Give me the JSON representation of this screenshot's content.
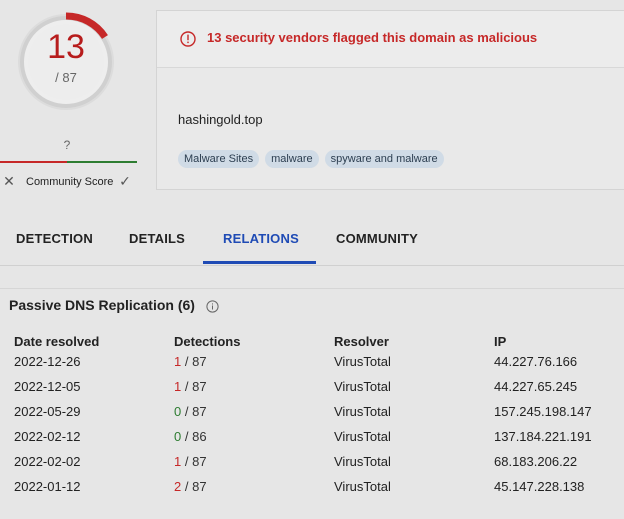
{
  "score": {
    "detected": "13",
    "total": "/ 87"
  },
  "community": {
    "question": "?",
    "label": "Community Score",
    "dislike_icon": "x-icon",
    "like_icon": "check-icon"
  },
  "alert": {
    "text": "13 security vendors flagged this domain as malicious",
    "icon": "alert-circle-icon",
    "color": "#c62828"
  },
  "domain": "hashingold.top",
  "tags": [
    "Malware Sites",
    "malware",
    "spyware and malware"
  ],
  "tabs": [
    {
      "label": "DETECTION",
      "active": false
    },
    {
      "label": "DETAILS",
      "active": false
    },
    {
      "label": "RELATIONS",
      "active": true
    },
    {
      "label": "COMMUNITY",
      "active": false
    }
  ],
  "passive_dns": {
    "title": "Passive DNS Replication (6)",
    "columns": [
      "Date resolved",
      "Detections",
      "Resolver",
      "IP"
    ],
    "rows": [
      {
        "date": "2022-12-26",
        "det": "1",
        "det_total": "/ 87",
        "resolver": "VirusTotal",
        "ip": "44.227.76.166"
      },
      {
        "date": "2022-12-05",
        "det": "1",
        "det_total": "/ 87",
        "resolver": "VirusTotal",
        "ip": "44.227.65.245"
      },
      {
        "date": "2022-05-29",
        "det": "0",
        "det_total": "/ 87",
        "resolver": "VirusTotal",
        "ip": "157.245.198.147"
      },
      {
        "date": "2022-02-12",
        "det": "0",
        "det_total": "/ 86",
        "resolver": "VirusTotal",
        "ip": "137.184.221.191"
      },
      {
        "date": "2022-02-02",
        "det": "1",
        "det_total": "/ 87",
        "resolver": "VirusTotal",
        "ip": "68.183.206.22"
      },
      {
        "date": "2022-01-12",
        "det": "2",
        "det_total": "/ 87",
        "resolver": "VirusTotal",
        "ip": "45.147.228.138"
      }
    ]
  },
  "colors": {
    "malicious": "#c62828",
    "clean": "#2e7d32",
    "accent": "#1f4bb5"
  }
}
